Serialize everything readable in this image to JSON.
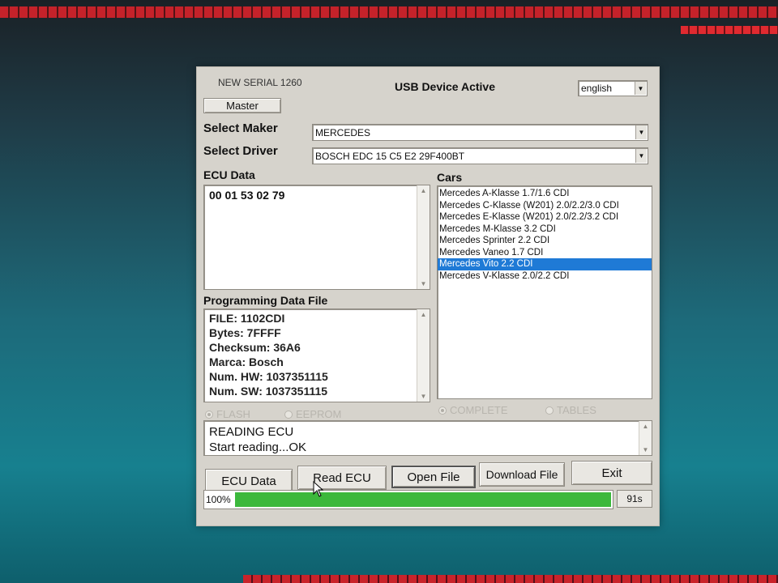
{
  "header": {
    "serial": "NEW SERIAL 1260",
    "status": "USB Device Active",
    "language": "english",
    "master_button": "Master"
  },
  "maker": {
    "label": "Select Maker",
    "value": "MERCEDES"
  },
  "driver": {
    "label": "Select Driver",
    "value": "BOSCH EDC 15 C5  E2 29F400BT"
  },
  "ecu_data": {
    "label": "ECU Data",
    "value": "00 01 53 02 79"
  },
  "programming": {
    "label": "Programming Data File",
    "lines": [
      "FILE: 1102CDI",
      "Bytes: 7FFFF",
      "Checksum: 36A6",
      "Marca: Bosch",
      "Num. HW: 1037351115",
      "Num. SW: 1037351115"
    ]
  },
  "cars": {
    "label": "Cars",
    "selected_index": 6,
    "items": [
      "Mercedes A-Klasse 1.7/1.6 CDI",
      "Mercedes C-Klasse (W201) 2.0/2.2/3.0 CDI",
      "Mercedes E-Klasse (W201) 2.0/2.2/3.2 CDI",
      "Mercedes M-Klasse 3.2 CDI",
      "Mercedes Sprinter 2.2 CDI",
      "Mercedes Vaneo 1.7 CDI",
      "Mercedes Vito 2.2 CDI",
      "Mercedes V-Klasse 2.0/2.2 CDI"
    ]
  },
  "options": {
    "flash": "FLASH",
    "eeprom": "EEPROM",
    "complete": "COMPLETE",
    "tables": "TABLES"
  },
  "log": {
    "lines": [
      "READING ECU",
      "Start reading...OK"
    ]
  },
  "buttons": {
    "ecu_data": "ECU Data",
    "read_ecu": "Read ECU",
    "open_file": "Open File",
    "download_file": "Download File",
    "exit": "Exit"
  },
  "progress": {
    "percent_text": "100%",
    "fraction": 1.0,
    "time": "91s"
  },
  "colors": {
    "selection": "#1f7ad6",
    "progress": "#3cb83c"
  }
}
